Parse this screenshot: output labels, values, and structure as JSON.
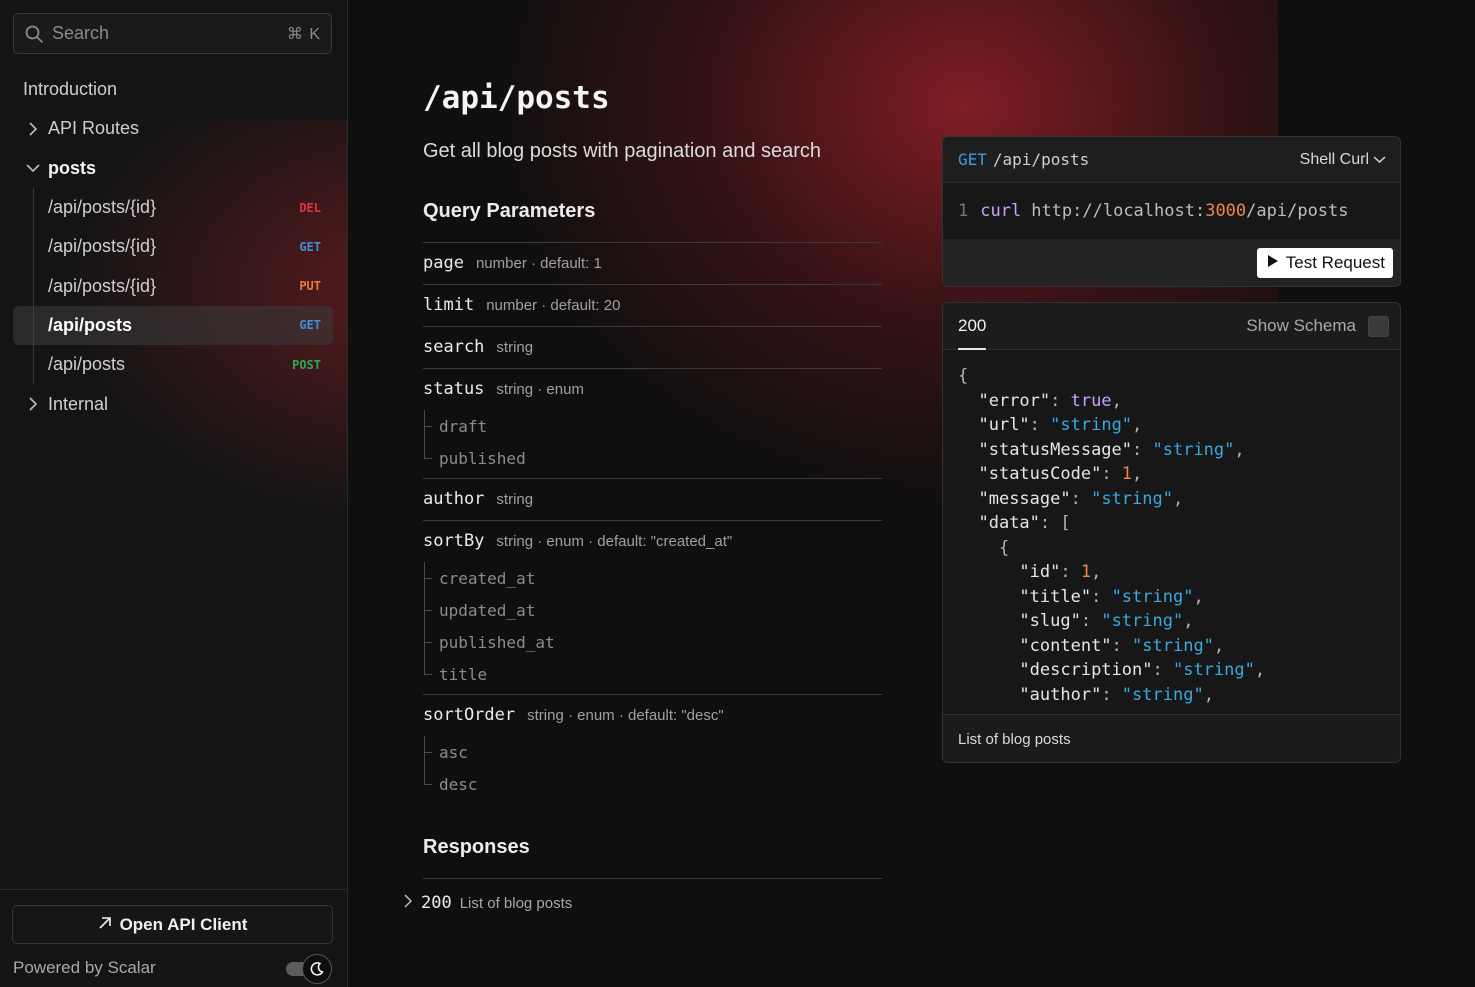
{
  "sidebar": {
    "search": {
      "placeholder": "Search",
      "shortcut": "⌘ K"
    },
    "items": [
      {
        "label": "Introduction"
      },
      {
        "label": "API Routes"
      },
      {
        "label": "posts"
      },
      {
        "label": "Internal"
      }
    ],
    "posts_children": [
      {
        "label": "/api/posts/{id}",
        "method": "DEL"
      },
      {
        "label": "/api/posts/{id}",
        "method": "GET"
      },
      {
        "label": "/api/posts/{id}",
        "method": "PUT"
      },
      {
        "label": "/api/posts",
        "method": "GET"
      },
      {
        "label": "/api/posts",
        "method": "POST"
      }
    ],
    "open_client_label": "Open API Client",
    "powered_by": "Powered by Scalar"
  },
  "main": {
    "title": "/api/posts",
    "description": "Get all blog posts with pagination and search",
    "query_params_heading": "Query Parameters",
    "params": [
      {
        "name": "page",
        "meta": "number · default: 1",
        "enum": []
      },
      {
        "name": "limit",
        "meta": "number · default: 20",
        "enum": []
      },
      {
        "name": "search",
        "meta": "string",
        "enum": []
      },
      {
        "name": "status",
        "meta": "string · enum",
        "enum": [
          "draft",
          "published"
        ]
      },
      {
        "name": "author",
        "meta": "string",
        "enum": []
      },
      {
        "name": "sortBy",
        "meta": "string · enum · default: \"created_at\"",
        "enum": [
          "created_at",
          "updated_at",
          "published_at",
          "title"
        ]
      },
      {
        "name": "sortOrder",
        "meta": "string · enum · default: \"desc\"",
        "enum": [
          "asc",
          "desc"
        ]
      }
    ],
    "responses_heading": "Responses",
    "responses": [
      {
        "code": "200",
        "description": "List of blog posts"
      }
    ]
  },
  "request_panel": {
    "method": "GET",
    "path": "/api/posts",
    "language": "Shell Curl",
    "line_number": "1",
    "command": "curl",
    "url_prefix": "http://localhost:",
    "port": "3000",
    "url_suffix": "/api/posts",
    "test_button": "Test Request"
  },
  "response_panel": {
    "status_tab": "200",
    "show_schema_label": "Show Schema",
    "footer": "List of blog posts",
    "json_lines": [
      [
        {
          "t": "p",
          "v": "{"
        }
      ],
      [
        {
          "t": "p",
          "v": "  "
        },
        {
          "t": "k",
          "v": "\"error\""
        },
        {
          "t": "p",
          "v": ": "
        },
        {
          "t": "b",
          "v": "true"
        },
        {
          "t": "p",
          "v": ","
        }
      ],
      [
        {
          "t": "p",
          "v": "  "
        },
        {
          "t": "k",
          "v": "\"url\""
        },
        {
          "t": "p",
          "v": ": "
        },
        {
          "t": "s",
          "v": "\"string\""
        },
        {
          "t": "p",
          "v": ","
        }
      ],
      [
        {
          "t": "p",
          "v": "  "
        },
        {
          "t": "k",
          "v": "\"statusMessage\""
        },
        {
          "t": "p",
          "v": ": "
        },
        {
          "t": "s",
          "v": "\"string\""
        },
        {
          "t": "p",
          "v": ","
        }
      ],
      [
        {
          "t": "p",
          "v": "  "
        },
        {
          "t": "k",
          "v": "\"statusCode\""
        },
        {
          "t": "p",
          "v": ": "
        },
        {
          "t": "n",
          "v": "1"
        },
        {
          "t": "p",
          "v": ","
        }
      ],
      [
        {
          "t": "p",
          "v": "  "
        },
        {
          "t": "k",
          "v": "\"message\""
        },
        {
          "t": "p",
          "v": ": "
        },
        {
          "t": "s",
          "v": "\"string\""
        },
        {
          "t": "p",
          "v": ","
        }
      ],
      [
        {
          "t": "p",
          "v": "  "
        },
        {
          "t": "k",
          "v": "\"data\""
        },
        {
          "t": "p",
          "v": ": ["
        }
      ],
      [
        {
          "t": "p",
          "v": "    {"
        }
      ],
      [
        {
          "t": "p",
          "v": "      "
        },
        {
          "t": "k",
          "v": "\"id\""
        },
        {
          "t": "p",
          "v": ": "
        },
        {
          "t": "n",
          "v": "1"
        },
        {
          "t": "p",
          "v": ","
        }
      ],
      [
        {
          "t": "p",
          "v": "      "
        },
        {
          "t": "k",
          "v": "\"title\""
        },
        {
          "t": "p",
          "v": ": "
        },
        {
          "t": "s",
          "v": "\"string\""
        },
        {
          "t": "p",
          "v": ","
        }
      ],
      [
        {
          "t": "p",
          "v": "      "
        },
        {
          "t": "k",
          "v": "\"slug\""
        },
        {
          "t": "p",
          "v": ": "
        },
        {
          "t": "s",
          "v": "\"string\""
        },
        {
          "t": "p",
          "v": ","
        }
      ],
      [
        {
          "t": "p",
          "v": "      "
        },
        {
          "t": "k",
          "v": "\"content\""
        },
        {
          "t": "p",
          "v": ": "
        },
        {
          "t": "s",
          "v": "\"string\""
        },
        {
          "t": "p",
          "v": ","
        }
      ],
      [
        {
          "t": "p",
          "v": "      "
        },
        {
          "t": "k",
          "v": "\"description\""
        },
        {
          "t": "p",
          "v": ": "
        },
        {
          "t": "s",
          "v": "\"string\""
        },
        {
          "t": "p",
          "v": ","
        }
      ],
      [
        {
          "t": "p",
          "v": "      "
        },
        {
          "t": "k",
          "v": "\"author\""
        },
        {
          "t": "p",
          "v": ": "
        },
        {
          "t": "s",
          "v": "\"string\""
        },
        {
          "t": "p",
          "v": ","
        }
      ]
    ]
  },
  "colors": {
    "accent_glow": "#9e222a",
    "method_del": "#e0343c",
    "method_get": "#3e8fd6",
    "method_put": "#ef7b33",
    "method_post": "#30a852"
  }
}
